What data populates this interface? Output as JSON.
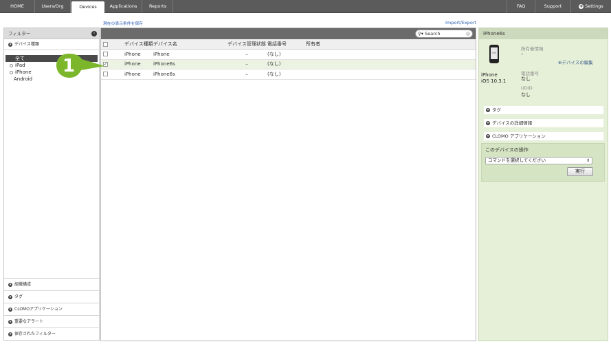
{
  "nav": {
    "tabs": [
      "HOME",
      "Users/Org",
      "Devices",
      "Applications",
      "Reports"
    ],
    "active": "Devices",
    "right": [
      "FAQ",
      "Support",
      "Settings"
    ]
  },
  "links": {
    "save_filter": "現在の表示条件を保存",
    "import_export": "Import/Export"
  },
  "sidebar": {
    "title": "フィルター",
    "section": "デバイス種類",
    "items": [
      "全て",
      "iPad",
      "iPhone",
      "Android"
    ],
    "bottom": [
      "組織構成",
      "タグ",
      "CLOMOアプリケーション",
      "重要なアラート",
      "保存されたフィルター"
    ]
  },
  "table": {
    "search_placeholder": "Search",
    "columns": [
      "デバイス種類",
      "デバイス名",
      "デバイス管理状態",
      "電話番号",
      "所有者"
    ],
    "rows": [
      {
        "checked": false,
        "type": "iPhone",
        "name": "iPhone",
        "status": "–",
        "phone": "(なし)",
        "owner": ""
      },
      {
        "checked": true,
        "type": "iPhone",
        "name": "iPhone6s",
        "status": "–",
        "phone": "(なし)",
        "owner": ""
      },
      {
        "checked": false,
        "type": "iPhone",
        "name": "iPhone6s",
        "status": "–",
        "phone": "(なし)",
        "owner": ""
      }
    ]
  },
  "callout": {
    "number": "1",
    "color": "#7cb62a"
  },
  "detail": {
    "title": "iPhone6s",
    "icon_label": "iOS",
    "model": "iPhone",
    "os": "iOS 10.3.1",
    "owner_label": "所有者情報",
    "owner_value": "–",
    "edit_link": "デバイスの編集",
    "phone_label": "電話番号",
    "phone_value": "なし",
    "udid_label": "UDID",
    "udid_value": "なし",
    "sections": [
      "タグ",
      "デバイスの詳細情報",
      "CLOMO アプリケーション"
    ],
    "ops_title": "このデバイスの操作",
    "ops_select": "コマンドを選択してください",
    "ops_button": "実行"
  },
  "colors": {
    "nav_bg": "#5b5b5b",
    "detail_bg": "#e6f0d8",
    "selected_row": "#ecf3e3",
    "callout": "#7cb62a"
  }
}
